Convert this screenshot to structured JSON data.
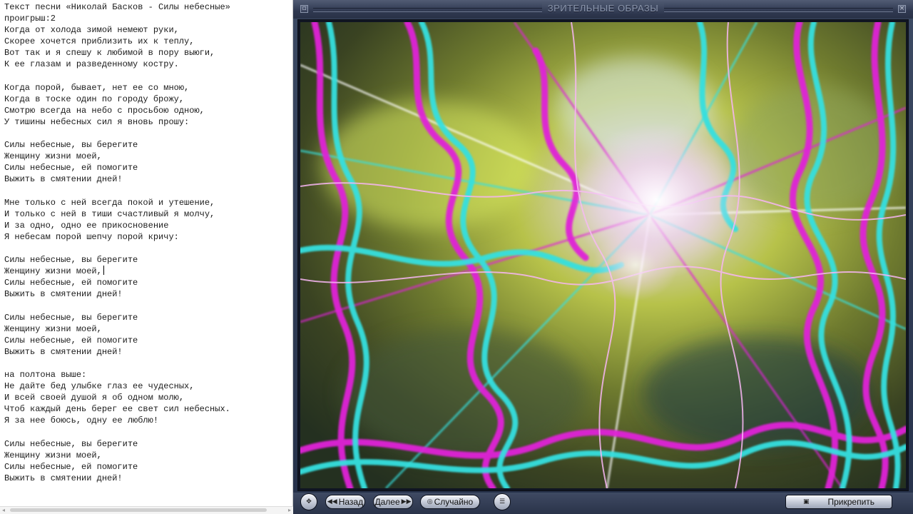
{
  "editor": {
    "lines": [
      "Текст песни «Николай Басков - Силы небесные»",
      "проигрыш:2",
      "Когда от холода зимой немеют руки,",
      "Скорее хочется приблизить их к теплу,",
      "Вот так и я спешу к любимой в пору выюги,",
      "К ее глазам и разведенному костру.",
      "",
      "Когда порой, бывает, нет ее со мною,",
      "Когда в тоске один по городу брожу,",
      "Смотрю всегда на небо с просьбою одною,",
      "У тишины небесных сил я вновь прошу:",
      "",
      "Силы небесные, вы берегите",
      "Женщину жизни моей,",
      "Силы небесные, ей помогите",
      "Выжить в смятении дней!",
      "",
      "Мне только с ней всегда покой и утешение,",
      "И только с ней в тиши счастливый я молчу,",
      "И за одно, одно ее прикосновение",
      "Я небесам порой шепчу порой кричу:",
      "",
      "Силы небесные, вы берегите",
      "Женщину жизни моей,",
      "Силы небесные, ей помогите",
      "Выжить в смятении дней!",
      "",
      "Силы небесные, вы берегите",
      "Женщину жизни моей,",
      "Силы небесные, ей помогите",
      "Выжить в смятении дней!",
      "",
      "на полтона выше:",
      "Не дайте бед улыбке глаз ее чудесных,",
      "И всей своей душой я об одном молю,",
      "Чтоб каждый день берег ее свет сил небесных.",
      "Я за нее боюсь, одну ее люблю!",
      "",
      "Силы небесные, вы берегите",
      "Женщину жизни моей,",
      "Силы небесные, ей помогите",
      "Выжить в смятении дней!"
    ],
    "caret_line": 23
  },
  "viz_window": {
    "title": "ЗРИТЕЛЬНЫЕ ОБРАЗЫ",
    "colors": {
      "magenta": "#e020d8",
      "cyan": "#35e0e0",
      "lime": "#c8e040",
      "white_glow": "#f4e8f6"
    }
  },
  "controls": {
    "back_label": "Назад",
    "next_label": "Далее",
    "random_label": "Случайно",
    "pin_label": "Прикрепить"
  }
}
